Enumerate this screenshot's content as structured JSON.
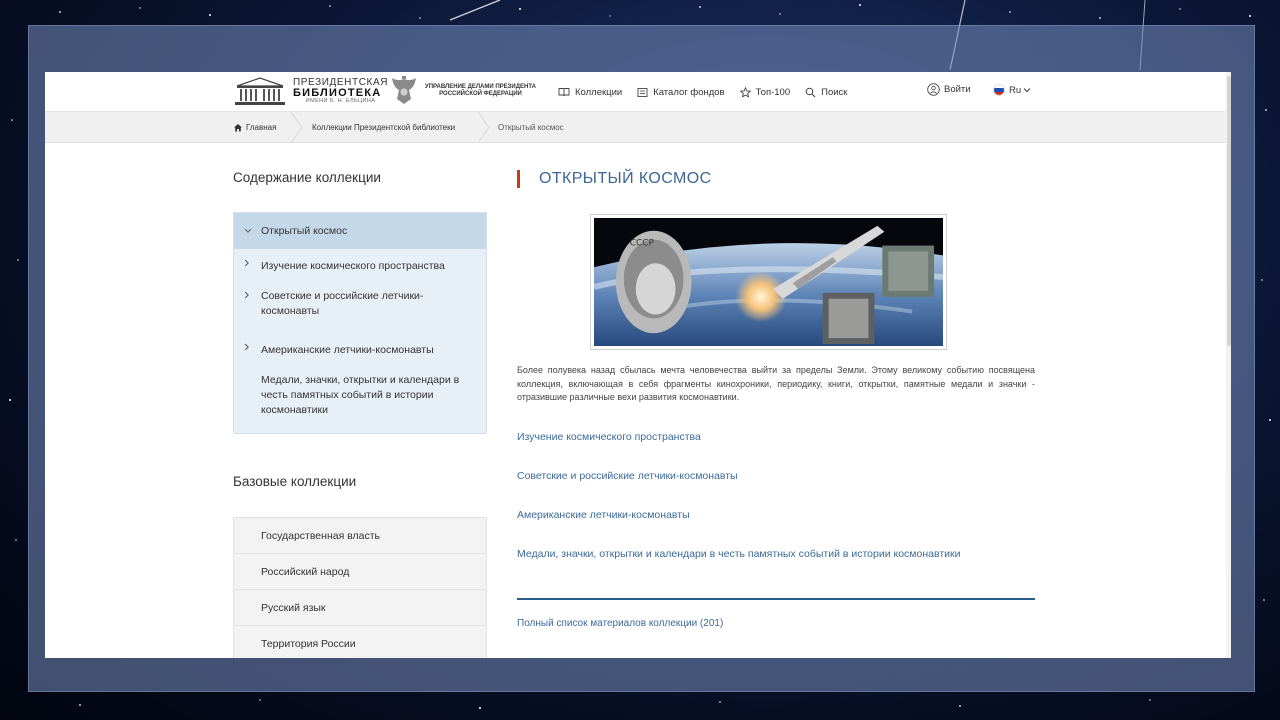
{
  "header": {
    "logo": {
      "line1": "ПРЕЗИДЕНТСКАЯ",
      "line2": "БИБЛИОТЕКА",
      "line3": "ИМЕНИ Б. Н. ЕЛЬЦИНА"
    },
    "admin": {
      "line1": "УПРАВЛЕНИЕ ДЕЛАМИ ПРЕЗИДЕНТА",
      "line2": "РОССИЙСКОЙ ФЕДЕРАЦИИ"
    },
    "nav": [
      {
        "label": "Коллекции",
        "icon": "book-icon"
      },
      {
        "label": "Каталог фондов",
        "icon": "catalog-icon"
      },
      {
        "label": "Топ-100",
        "icon": "star-icon"
      },
      {
        "label": "Поиск",
        "icon": "search-icon"
      }
    ],
    "login_label": "Войти",
    "lang_label": "Ru"
  },
  "breadcrumb": [
    {
      "label": "Главная",
      "icon": "home-icon"
    },
    {
      "label": "Коллекции Президентской библиотеки"
    },
    {
      "label": "Открытый космос"
    }
  ],
  "sidebar": {
    "contents_title": "Содержание коллекции",
    "items": [
      {
        "label": "Открытый космос",
        "active": true,
        "expanded": true
      },
      {
        "label": "Изучение космического пространства",
        "active": false
      },
      {
        "label": "Советские и российские летчики-космонавты",
        "active": false
      },
      {
        "label": "Американские летчики-космонавты",
        "active": false
      },
      {
        "label": "Медали, значки, открытки и календари в честь памятных событий в истории космонавтики",
        "active": false
      }
    ],
    "base_title": "Базовые коллекции",
    "base_items": [
      {
        "label": "Государственная власть"
      },
      {
        "label": "Российский народ"
      },
      {
        "label": "Русский язык"
      },
      {
        "label": "Территория России"
      }
    ]
  },
  "main": {
    "title": "ОТКРЫТЫЙ КОСМОС",
    "description": "Более полувека назад сбылась мечта человечества выйти за пределы Земли. Этому великому событию посвящена коллекция, включающая в себя фрагменты кинохроники, периодику, книги, открытки, памятные медали и значки - отразившие различные вехи развития космонавтики.",
    "links": [
      {
        "label": "Изучение космического пространства"
      },
      {
        "label": "Советские и российские летчики-космонавты"
      },
      {
        "label": "Американские летчики-космонавты"
      },
      {
        "label": "Медали, значки, открытки и календари в честь памятных событий в истории космонавтики"
      }
    ],
    "full_list_label": "Полный список материалов коллекции (201)"
  },
  "colors": {
    "accent_red": "#c33d1b",
    "title_blue": "#3c6693",
    "link_blue": "#3b6b99",
    "sidebar_bg": "#e8f0f7",
    "sidebar_active": "#c5d8ea"
  }
}
